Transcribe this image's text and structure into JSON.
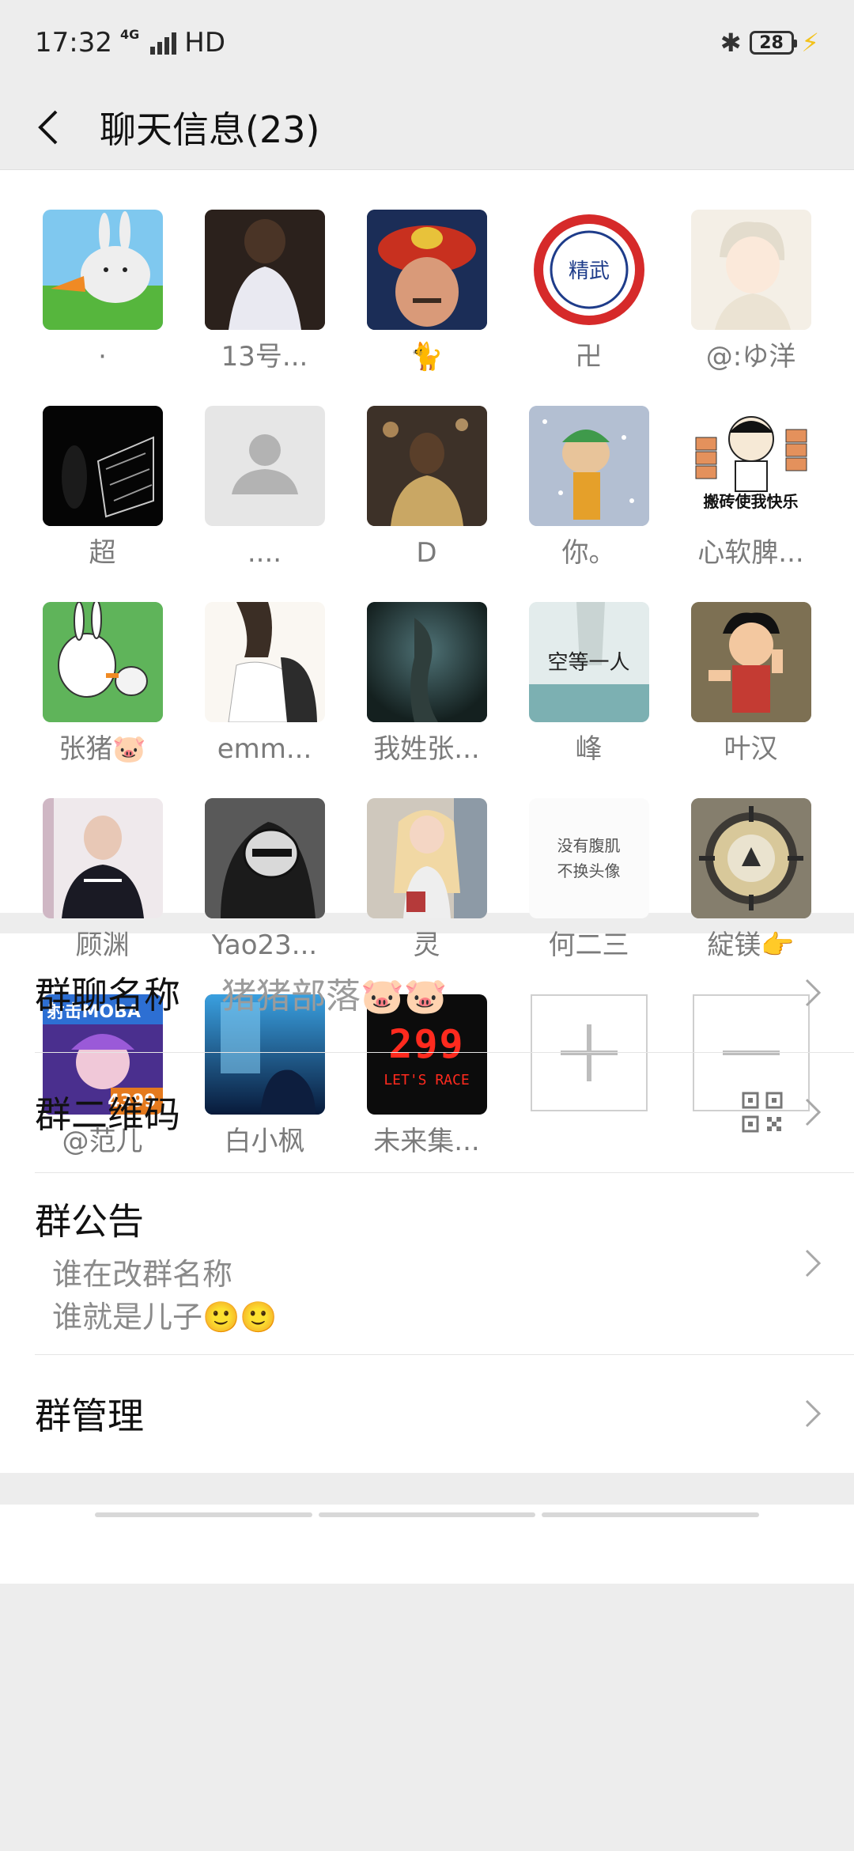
{
  "status_bar": {
    "time": "17:32",
    "network_small": "4G",
    "hd": "HD",
    "battery": "28"
  },
  "header": {
    "title": "聊天信息(23)"
  },
  "members": [
    {
      "name": "·",
      "avatar": "bunny-carrot"
    },
    {
      "name": "13号...",
      "avatar": "boy-white-shirt"
    },
    {
      "name": "🐈",
      "avatar": "man-red-hat"
    },
    {
      "name": "卍",
      "avatar": "taekwondo-logo"
    },
    {
      "name": "@:ゆ洋",
      "avatar": "anime-boy"
    },
    {
      "name": "超",
      "avatar": "dark-cage"
    },
    {
      "name": "....",
      "avatar": "default-person"
    },
    {
      "name": "D",
      "avatar": "blurred-street"
    },
    {
      "name": "你。",
      "avatar": "cartoon-snow"
    },
    {
      "name": "心软脾...",
      "avatar": "meme-bricks"
    },
    {
      "name": "张猪🐷",
      "avatar": "crayon-bunny"
    },
    {
      "name": "emm...",
      "avatar": "anime-backpack"
    },
    {
      "name": "我姓张...",
      "avatar": "dark-hand"
    },
    {
      "name": "峰",
      "avatar": "text-kongdeng"
    },
    {
      "name": "叶汉",
      "avatar": "astro-boy"
    },
    {
      "name": "顾渊",
      "avatar": "girl-mirror"
    },
    {
      "name": "Yao23...",
      "avatar": "manga-mask"
    },
    {
      "name": "灵",
      "avatar": "blonde-girl"
    },
    {
      "name": "何二三",
      "avatar": "calligraphy-text"
    },
    {
      "name": "綻镁👉",
      "avatar": "ship-wheel"
    },
    {
      "name": "@范儿",
      "avatar": "moba-game"
    },
    {
      "name": "白小枫",
      "avatar": "blue-window"
    },
    {
      "name": "未来集...",
      "avatar": "digital-299"
    }
  ],
  "avatar_texts": {
    "meme_caption": "搬砖使我快乐",
    "kongdeng": "空等一人",
    "calligraphy": "没有腹肌 不换头像",
    "moba_top": "射击MOBA",
    "moba_bottom": "4399",
    "digital_num": "299",
    "digital_lets": "LET'S RACE",
    "taekwondo_word": "精武"
  },
  "settings": {
    "group_name_label": "群聊名称",
    "group_name_value": "猪猪部落🐷🐷",
    "qr_label": "群二维码",
    "notice_label": "群公告",
    "notice_line1": "谁在改群名称",
    "notice_line2": "谁就是儿子🙂🙂",
    "manage_label": "群管理"
  }
}
